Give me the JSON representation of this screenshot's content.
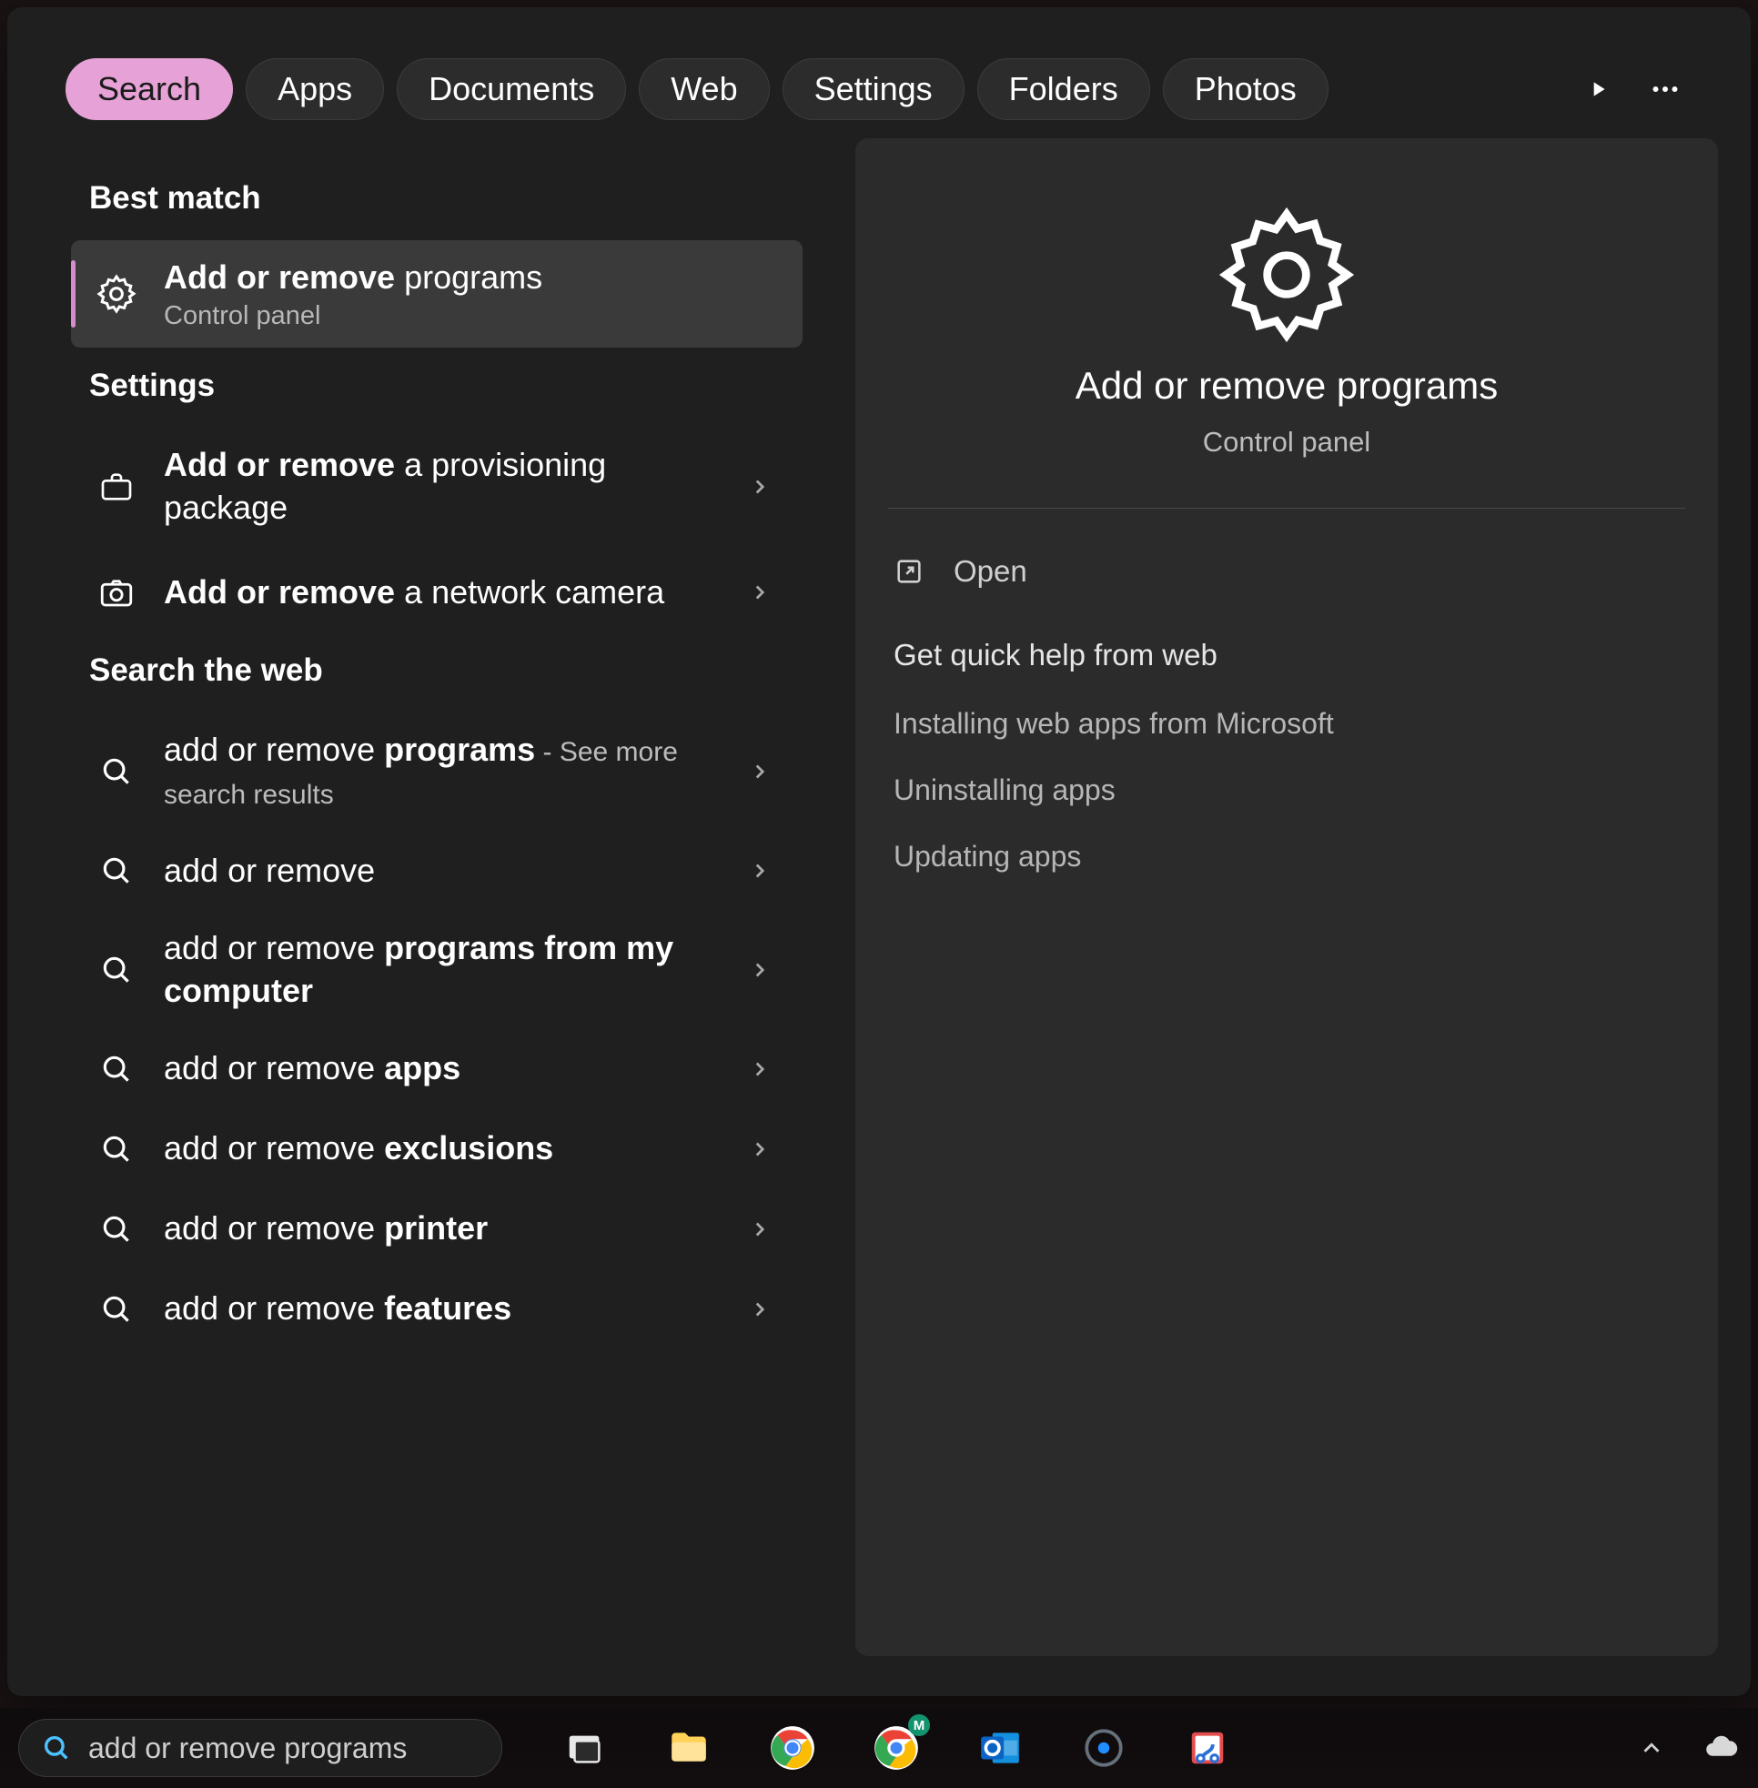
{
  "tabs": [
    "Search",
    "Apps",
    "Documents",
    "Web",
    "Settings",
    "Folders",
    "Photos"
  ],
  "active_tab_index": 0,
  "sections": {
    "best_match": {
      "title": "Best match",
      "item": {
        "line1_bold": "Add or remove",
        "line1_rest": " programs",
        "line2": "Control panel"
      }
    },
    "settings": {
      "title": "Settings",
      "items": [
        {
          "line1_bold": "Add or remove",
          "line1_rest": " a provisioning package",
          "icon": "briefcase"
        },
        {
          "line1_bold": "Add or remove",
          "line1_rest": " a network camera",
          "icon": "camera"
        }
      ]
    },
    "web": {
      "title": "Search the web",
      "items": [
        {
          "prefix": "add or remove ",
          "bold": "programs",
          "suffix": " - See more search results"
        },
        {
          "prefix": "add or remove",
          "bold": "",
          "suffix": ""
        },
        {
          "prefix": "add or remove ",
          "bold": "programs from my computer",
          "suffix": ""
        },
        {
          "prefix": "add or remove ",
          "bold": "apps",
          "suffix": ""
        },
        {
          "prefix": "add or remove ",
          "bold": "exclusions",
          "suffix": ""
        },
        {
          "prefix": "add or remove ",
          "bold": "printer",
          "suffix": ""
        },
        {
          "prefix": "add or remove ",
          "bold": "features",
          "suffix": ""
        }
      ]
    }
  },
  "preview": {
    "title": "Add or remove programs",
    "subtitle": "Control panel",
    "open_label": "Open",
    "help_title": "Get quick help from web",
    "help_links": [
      "Installing web apps from Microsoft",
      "Uninstalling apps",
      "Updating apps"
    ]
  },
  "taskbar": {
    "search_value": "add or remove programs",
    "items": [
      "task-view",
      "file-explorer",
      "chrome",
      "chrome-profile",
      "outlook",
      "settings",
      "snipping-tool"
    ]
  }
}
